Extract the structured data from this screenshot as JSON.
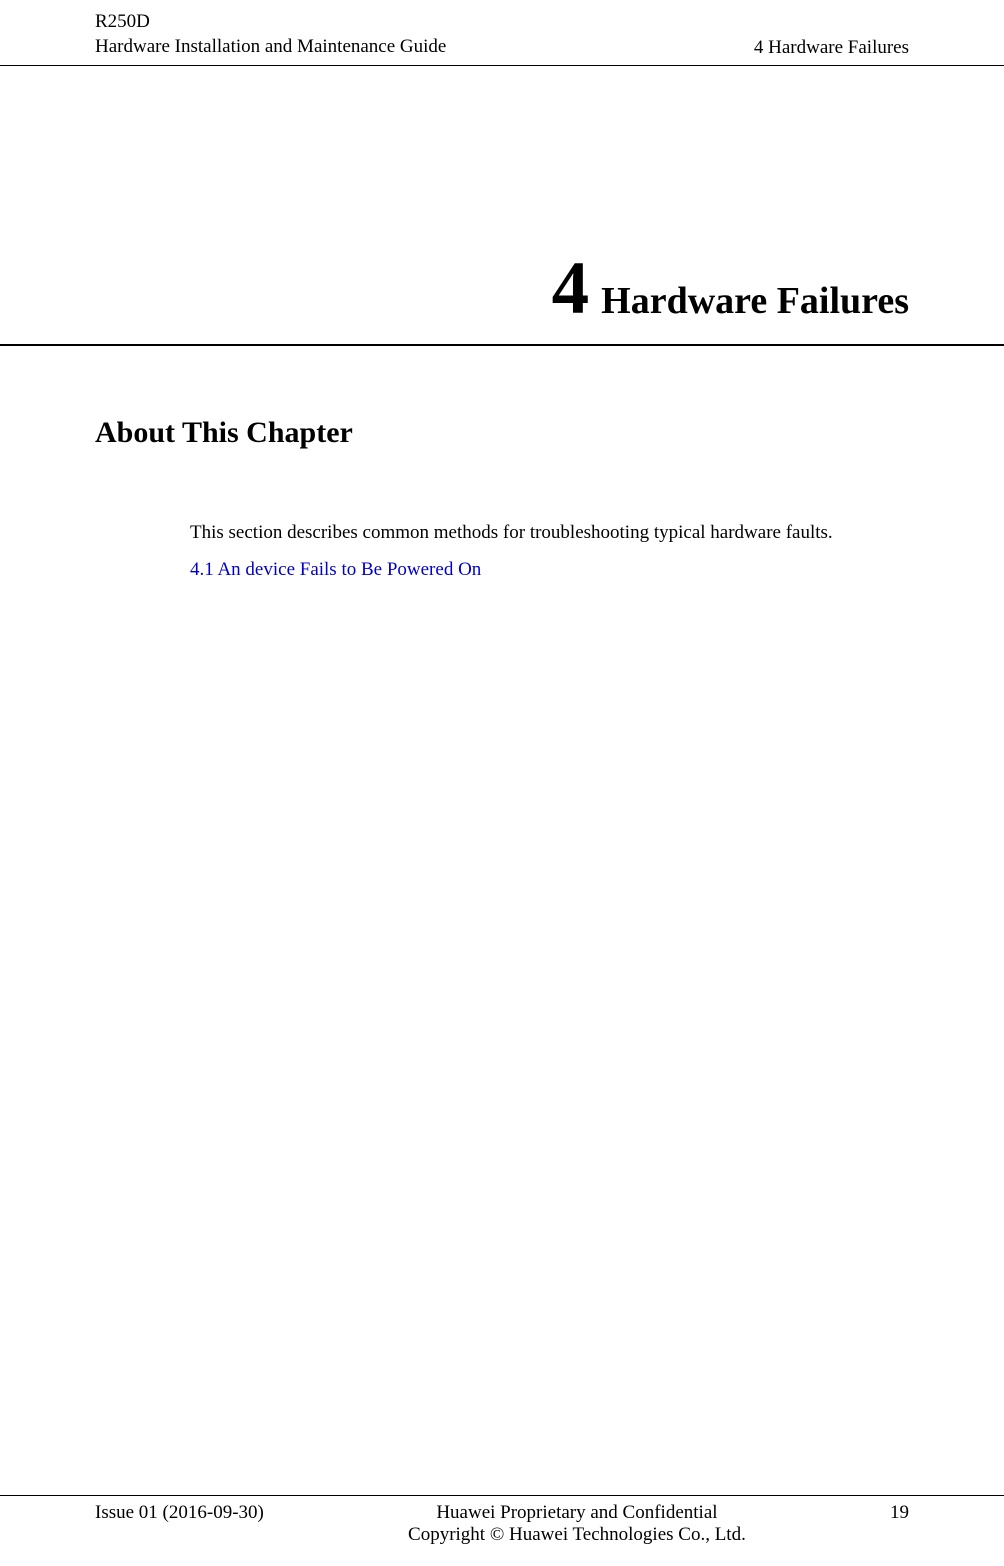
{
  "header": {
    "product": "R250D",
    "guide": "Hardware Installation and Maintenance Guide",
    "chapter_ref": "4 Hardware Failures"
  },
  "chapter": {
    "number": "4",
    "title": "Hardware Failures"
  },
  "section_heading": "About This Chapter",
  "intro_paragraph": "This section describes common methods for troubleshooting typical hardware faults.",
  "toc_link": "4.1 An device Fails to Be Powered On",
  "footer": {
    "issue": "Issue 01 (2016-09-30)",
    "line1": "Huawei Proprietary and Confidential",
    "line2": "Copyright © Huawei Technologies Co., Ltd.",
    "page": "19"
  }
}
